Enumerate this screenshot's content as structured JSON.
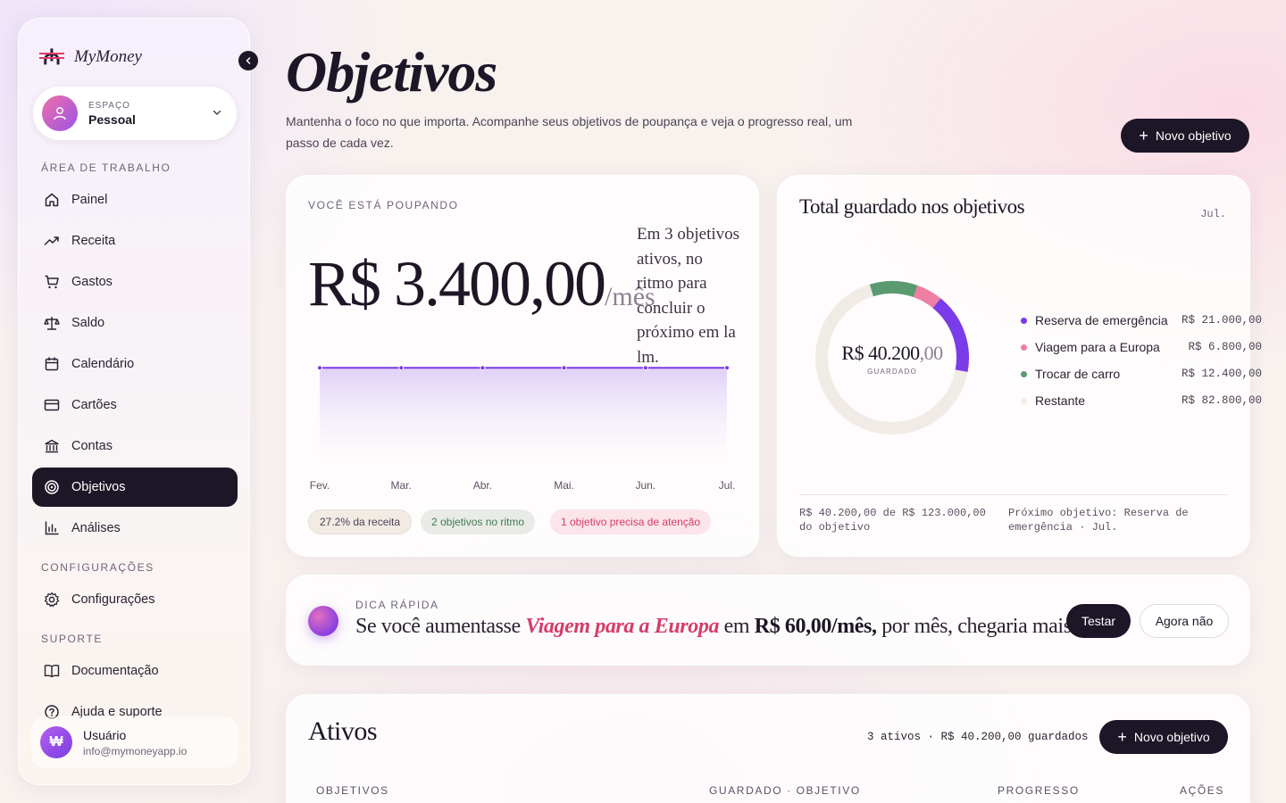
{
  "sidebar": {
    "brand_mark": "₼",
    "brand_name": "MyMoney",
    "workspace_label": "ESPAÇO",
    "workspace_value": "Pessoal",
    "section_work": "ÁREA DE TRABALHO",
    "items": [
      {
        "label": "Painel",
        "icon": "home-icon"
      },
      {
        "label": "Receita",
        "icon": "trend-up-icon"
      },
      {
        "label": "Gastos",
        "icon": "cart-icon"
      },
      {
        "label": "Saldo",
        "icon": "scale-icon"
      },
      {
        "label": "Calendário",
        "icon": "calendar-icon"
      },
      {
        "label": "Cartões",
        "icon": "credit-card-icon"
      },
      {
        "label": "Contas",
        "icon": "bank-icon"
      },
      {
        "label": "Objetivos",
        "icon": "target-icon",
        "active": true
      },
      {
        "label": "Análises",
        "icon": "bar-chart-icon"
      }
    ],
    "section_config": "CONFIGURAÇÕES",
    "config_item": "Configurações",
    "section_support": "SUPORTE",
    "support_items": [
      "Documentação",
      "Ajuda e suporte"
    ],
    "user": {
      "initial": "₩",
      "name": "Usuário",
      "email": "info@mymoneyapp.io"
    }
  },
  "header": {
    "title": "Objetivos",
    "description": "Mantenha o foco no que importa. Acompanhe seus objetivos de poupança e veja o progresso real, um passo de cada vez.",
    "new_button": "Novo objetivo"
  },
  "savings": {
    "overline": "VOCÊ ESTÁ POUPANDO",
    "amount": "R$ 3.400,00",
    "per": "/mês",
    "note": "Em 3 objetivos ativos, no ritmo para concluir o próximo em la lm.",
    "pills": [
      "27.2% da receita",
      "2 objetivos no ritmo",
      "1 objetivo precisa de atenção"
    ]
  },
  "chart_data": {
    "type": "area",
    "x": [
      "Fev.",
      "Mar.",
      "Abr.",
      "Mai.",
      "Jun.",
      "Jul."
    ],
    "values": [
      3400,
      3400,
      3400,
      3400,
      3400,
      3400
    ],
    "ylim": [
      0,
      4000
    ],
    "grid": false
  },
  "total": {
    "title": "Total guardado nos objetivos",
    "month": "Jul.",
    "center_amount": "R$ 40.200",
    "center_cents": ",00",
    "center_label": "GUARDADO",
    "segments": [
      {
        "name": "Reserva de emergência",
        "value": "R$ 21.000,00",
        "amount": 21000,
        "color": "#7a3be8"
      },
      {
        "name": "Viagem para a Europa",
        "value": "R$ 6.800,00",
        "amount": 6800,
        "color": "#ef7fa2"
      },
      {
        "name": "Trocar de carro",
        "value": "R$ 12.400,00",
        "amount": 12400,
        "color": "#5a9a70"
      },
      {
        "name": "Restante",
        "value": "R$ 82.800,00",
        "amount": 82800,
        "color": "#f1ebe6"
      }
    ],
    "foot_left": "R$ 40.200,00 de R$ 123.000,00 do objetivo",
    "foot_right": "Próximo objetivo: Reserva de emergência · Jul."
  },
  "tip": {
    "overline": "DICA RÁPIDA",
    "pre": "Se você aumentasse ",
    "highlight": "Viagem para a Europa",
    "mid": " em ",
    "amount": "R$ 60,00/mês,",
    "post": " por mês, chegaria mais cedo.",
    "try_button": "Testar",
    "dismiss_button": "Agora não"
  },
  "active": {
    "title": "Ativos",
    "summary": "3 ativos · R$ 40.200,00 guardados",
    "new_button": "Novo objetivo",
    "columns": [
      "OBJETIVOS",
      "GUARDADO · OBJETIVO",
      "PROGRESSO",
      "AÇÕES"
    ]
  }
}
